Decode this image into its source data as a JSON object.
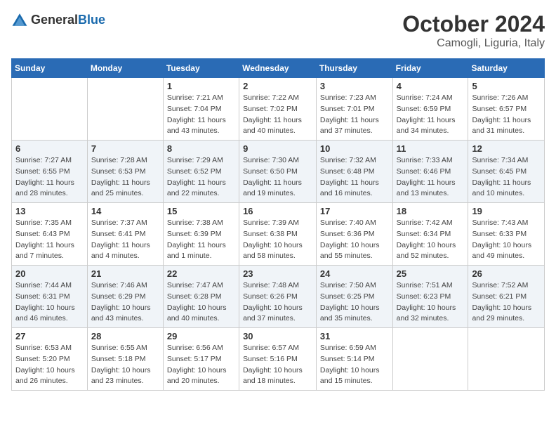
{
  "header": {
    "logo": {
      "general": "General",
      "blue": "Blue"
    },
    "month": "October 2024",
    "location": "Camogli, Liguria, Italy"
  },
  "days_of_week": [
    "Sunday",
    "Monday",
    "Tuesday",
    "Wednesday",
    "Thursday",
    "Friday",
    "Saturday"
  ],
  "weeks": [
    [
      {
        "day": "",
        "info": ""
      },
      {
        "day": "",
        "info": ""
      },
      {
        "day": "1",
        "info": "Sunrise: 7:21 AM\nSunset: 7:04 PM\nDaylight: 11 hours and 43 minutes."
      },
      {
        "day": "2",
        "info": "Sunrise: 7:22 AM\nSunset: 7:02 PM\nDaylight: 11 hours and 40 minutes."
      },
      {
        "day": "3",
        "info": "Sunrise: 7:23 AM\nSunset: 7:01 PM\nDaylight: 11 hours and 37 minutes."
      },
      {
        "day": "4",
        "info": "Sunrise: 7:24 AM\nSunset: 6:59 PM\nDaylight: 11 hours and 34 minutes."
      },
      {
        "day": "5",
        "info": "Sunrise: 7:26 AM\nSunset: 6:57 PM\nDaylight: 11 hours and 31 minutes."
      }
    ],
    [
      {
        "day": "6",
        "info": "Sunrise: 7:27 AM\nSunset: 6:55 PM\nDaylight: 11 hours and 28 minutes."
      },
      {
        "day": "7",
        "info": "Sunrise: 7:28 AM\nSunset: 6:53 PM\nDaylight: 11 hours and 25 minutes."
      },
      {
        "day": "8",
        "info": "Sunrise: 7:29 AM\nSunset: 6:52 PM\nDaylight: 11 hours and 22 minutes."
      },
      {
        "day": "9",
        "info": "Sunrise: 7:30 AM\nSunset: 6:50 PM\nDaylight: 11 hours and 19 minutes."
      },
      {
        "day": "10",
        "info": "Sunrise: 7:32 AM\nSunset: 6:48 PM\nDaylight: 11 hours and 16 minutes."
      },
      {
        "day": "11",
        "info": "Sunrise: 7:33 AM\nSunset: 6:46 PM\nDaylight: 11 hours and 13 minutes."
      },
      {
        "day": "12",
        "info": "Sunrise: 7:34 AM\nSunset: 6:45 PM\nDaylight: 11 hours and 10 minutes."
      }
    ],
    [
      {
        "day": "13",
        "info": "Sunrise: 7:35 AM\nSunset: 6:43 PM\nDaylight: 11 hours and 7 minutes."
      },
      {
        "day": "14",
        "info": "Sunrise: 7:37 AM\nSunset: 6:41 PM\nDaylight: 11 hours and 4 minutes."
      },
      {
        "day": "15",
        "info": "Sunrise: 7:38 AM\nSunset: 6:39 PM\nDaylight: 11 hours and 1 minute."
      },
      {
        "day": "16",
        "info": "Sunrise: 7:39 AM\nSunset: 6:38 PM\nDaylight: 10 hours and 58 minutes."
      },
      {
        "day": "17",
        "info": "Sunrise: 7:40 AM\nSunset: 6:36 PM\nDaylight: 10 hours and 55 minutes."
      },
      {
        "day": "18",
        "info": "Sunrise: 7:42 AM\nSunset: 6:34 PM\nDaylight: 10 hours and 52 minutes."
      },
      {
        "day": "19",
        "info": "Sunrise: 7:43 AM\nSunset: 6:33 PM\nDaylight: 10 hours and 49 minutes."
      }
    ],
    [
      {
        "day": "20",
        "info": "Sunrise: 7:44 AM\nSunset: 6:31 PM\nDaylight: 10 hours and 46 minutes."
      },
      {
        "day": "21",
        "info": "Sunrise: 7:46 AM\nSunset: 6:29 PM\nDaylight: 10 hours and 43 minutes."
      },
      {
        "day": "22",
        "info": "Sunrise: 7:47 AM\nSunset: 6:28 PM\nDaylight: 10 hours and 40 minutes."
      },
      {
        "day": "23",
        "info": "Sunrise: 7:48 AM\nSunset: 6:26 PM\nDaylight: 10 hours and 37 minutes."
      },
      {
        "day": "24",
        "info": "Sunrise: 7:50 AM\nSunset: 6:25 PM\nDaylight: 10 hours and 35 minutes."
      },
      {
        "day": "25",
        "info": "Sunrise: 7:51 AM\nSunset: 6:23 PM\nDaylight: 10 hours and 32 minutes."
      },
      {
        "day": "26",
        "info": "Sunrise: 7:52 AM\nSunset: 6:21 PM\nDaylight: 10 hours and 29 minutes."
      }
    ],
    [
      {
        "day": "27",
        "info": "Sunrise: 6:53 AM\nSunset: 5:20 PM\nDaylight: 10 hours and 26 minutes."
      },
      {
        "day": "28",
        "info": "Sunrise: 6:55 AM\nSunset: 5:18 PM\nDaylight: 10 hours and 23 minutes."
      },
      {
        "day": "29",
        "info": "Sunrise: 6:56 AM\nSunset: 5:17 PM\nDaylight: 10 hours and 20 minutes."
      },
      {
        "day": "30",
        "info": "Sunrise: 6:57 AM\nSunset: 5:16 PM\nDaylight: 10 hours and 18 minutes."
      },
      {
        "day": "31",
        "info": "Sunrise: 6:59 AM\nSunset: 5:14 PM\nDaylight: 10 hours and 15 minutes."
      },
      {
        "day": "",
        "info": ""
      },
      {
        "day": "",
        "info": ""
      }
    ]
  ]
}
